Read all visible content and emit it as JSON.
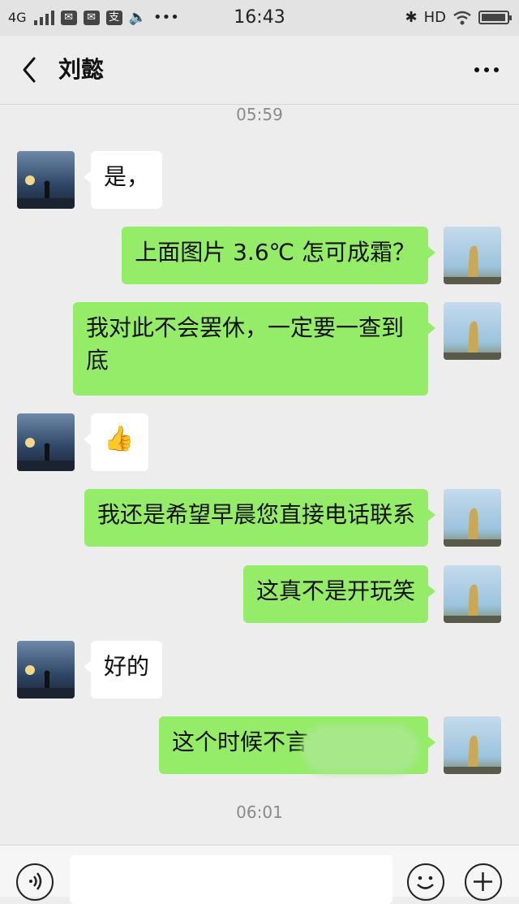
{
  "status_bar": {
    "network": "4G",
    "time": "16:43",
    "hd": "HD",
    "notif_icon_3": "支"
  },
  "nav": {
    "title": "刘懿"
  },
  "timestamps": [
    "05:59",
    "06:01"
  ],
  "messages": [
    {
      "side": "in",
      "text": "是，"
    },
    {
      "side": "out",
      "text": "上面图片 3.6℃ 怎可成霜？"
    },
    {
      "side": "out",
      "text": "我对此不会罢休，一定要一查到底"
    },
    {
      "side": "in",
      "text": "👍"
    },
    {
      "side": "out",
      "text": "我还是希望早晨您直接电话联系"
    },
    {
      "side": "out",
      "text": "这真不是开玩笑"
    },
    {
      "side": "in",
      "text": "好的"
    },
    {
      "side": "out",
      "text": "这个时候不言"
    }
  ],
  "input": {
    "placeholder": ""
  },
  "colors": {
    "background": "#ededed",
    "out_bubble": "#95ec69",
    "in_bubble": "#ffffff"
  }
}
